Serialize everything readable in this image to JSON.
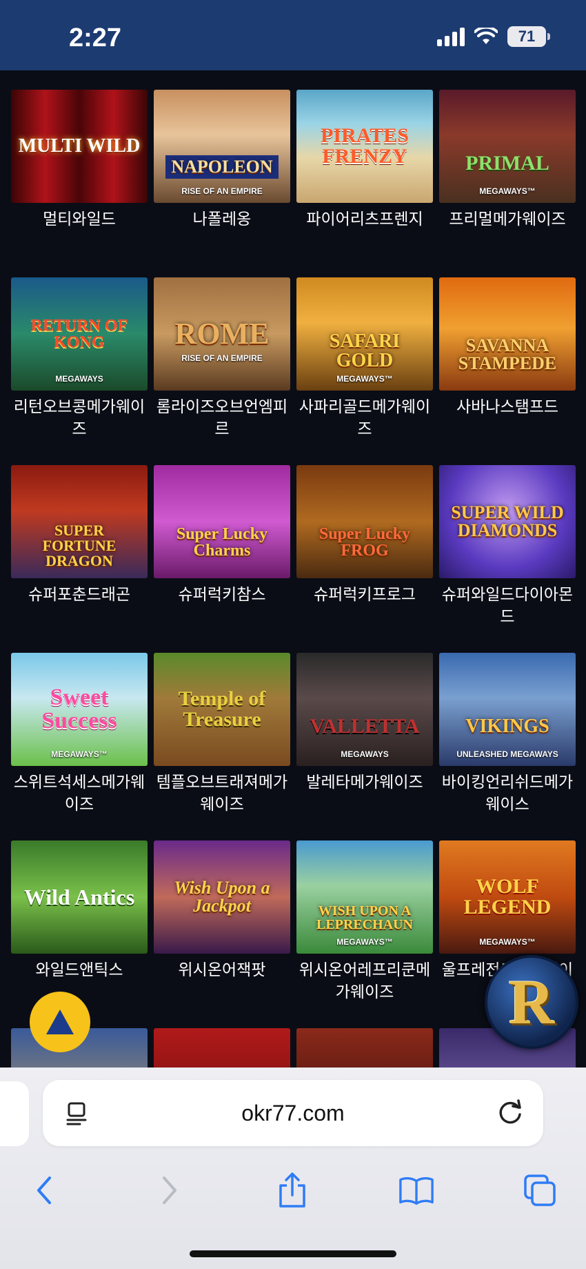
{
  "status_bar": {
    "time": "2:27",
    "battery": "71"
  },
  "games": [
    {
      "caption": "멀티와일드",
      "art_text": "MULTI WILD",
      "art_sub": ""
    },
    {
      "caption": "나폴레옹",
      "art_text": "NAPOLEON",
      "art_sub": "RISE OF AN EMPIRE"
    },
    {
      "caption": "파이어리츠프렌지",
      "art_text": "PIRATES FRENZY",
      "art_sub": ""
    },
    {
      "caption": "프리멀메가웨이즈",
      "art_text": "PRIMAL",
      "art_sub": "MEGAWAYS™"
    },
    {
      "caption": "리턴오브콩메가웨이즈",
      "art_text": "RETURN OF KONG",
      "art_sub": "MEGAWAYS"
    },
    {
      "caption": "롬라이즈오브언엠피르",
      "art_text": "ROME",
      "art_sub": "RISE OF AN EMPIRE"
    },
    {
      "caption": "사파리골드메가웨이즈",
      "art_text": "SAFARI GOLD",
      "art_sub": "MEGAWAYS™"
    },
    {
      "caption": "사바나스탬프드",
      "art_text": "SAVANNA STAMPEDE",
      "art_sub": ""
    },
    {
      "caption": "슈퍼포춘드래곤",
      "art_text": "SUPER FORTUNE DRAGON",
      "art_sub": ""
    },
    {
      "caption": "슈퍼럭키참스",
      "art_text": "Super Lucky Charms",
      "art_sub": ""
    },
    {
      "caption": "슈퍼럭키프로그",
      "art_text": "Super Lucky FROG",
      "art_sub": ""
    },
    {
      "caption": "슈퍼와일드다이아몬드",
      "art_text": "SUPER WILD DIAMONDS",
      "art_sub": ""
    },
    {
      "caption": "스위트석세스메가웨이즈",
      "art_text": "Sweet Success",
      "art_sub": "MEGAWAYS™"
    },
    {
      "caption": "템플오브트래져메가웨이즈",
      "art_text": "Temple of Treasure",
      "art_sub": ""
    },
    {
      "caption": "발레타메가웨이즈",
      "art_text": "VALLETTA",
      "art_sub": "MEGAWAYS"
    },
    {
      "caption": "바이킹언리쉬드메가웨이스",
      "art_text": "VIKINGS",
      "art_sub": "UNLEASHED MEGAWAYS"
    },
    {
      "caption": "와일드앤틱스",
      "art_text": "Wild Antics",
      "art_sub": ""
    },
    {
      "caption": "위시온어잭팟",
      "art_text": "Wish Upon a Jackpot",
      "art_sub": ""
    },
    {
      "caption": "위시온어레프리쿤메가웨이즈",
      "art_text": "WISH UPON A LEPRECHAUN",
      "art_sub": "MEGAWAYS™"
    },
    {
      "caption": "울프레전드메가웨이즈",
      "art_text": "WOLF LEGEND",
      "art_sub": "MEGAWAYS™"
    },
    {
      "caption": "",
      "art_text": "",
      "art_sub": ""
    },
    {
      "caption": "",
      "art_text": "",
      "art_sub": ""
    },
    {
      "caption": "",
      "art_text": "",
      "art_sub": ""
    },
    {
      "caption": "",
      "art_text": "",
      "art_sub": ""
    }
  ],
  "floating": {
    "badge_letter": "R"
  },
  "browser": {
    "url": "okr77.com"
  }
}
